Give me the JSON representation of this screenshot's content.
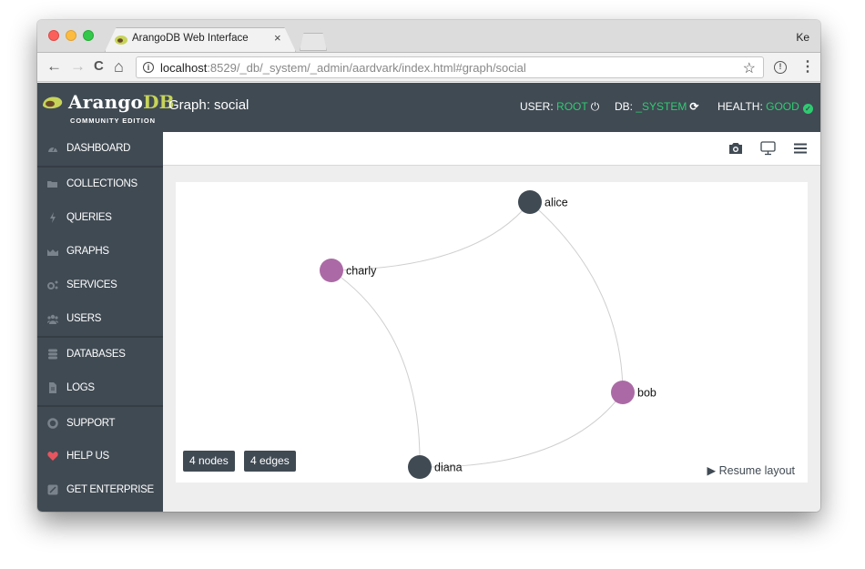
{
  "browser": {
    "tab_title": "ArangoDB Web Interface",
    "tab_close": "×",
    "profile": "Ke",
    "url_host": "localhost",
    "url_rest": ":8529/_db/_system/_admin/aardvark/index.html#graph/social",
    "back": "←",
    "forward": "→",
    "reload": "C",
    "home": "⌂",
    "info": "i",
    "star": "☆",
    "ext": "!",
    "menu": "⋮"
  },
  "header": {
    "logo_main": "Arango",
    "logo_db": "DB",
    "logo_sub": "COMMUNITY EDITION",
    "title": "Graph: social",
    "user_label": "USER:",
    "user_value": "ROOT",
    "db_label": "DB:",
    "db_value": "_SYSTEM",
    "health_label": "HEALTH:",
    "health_value": "GOOD",
    "power_icon": "⏻",
    "refresh_icon": "⟳",
    "check_icon": "✓"
  },
  "sidebar": {
    "items": [
      {
        "label": "DASHBOARD",
        "icon": "dashboard-icon"
      },
      {
        "label": "COLLECTIONS",
        "icon": "folder-icon"
      },
      {
        "label": "QUERIES",
        "icon": "bolt-icon"
      },
      {
        "label": "GRAPHS",
        "icon": "area-chart-icon"
      },
      {
        "label": "SERVICES",
        "icon": "cogs-icon"
      },
      {
        "label": "USERS",
        "icon": "users-icon"
      },
      {
        "label": "DATABASES",
        "icon": "database-icon"
      },
      {
        "label": "LOGS",
        "icon": "file-icon"
      },
      {
        "label": "SUPPORT",
        "icon": "life-ring-icon"
      },
      {
        "label": "HELP US",
        "icon": "heart-icon"
      },
      {
        "label": "GET ENTERPRISE",
        "icon": "external-link-icon"
      }
    ]
  },
  "graph": {
    "nodes": [
      {
        "id": "alice",
        "label": "alice",
        "color": "#404a53"
      },
      {
        "id": "charly",
        "label": "charly",
        "color": "#ab6aa5"
      },
      {
        "id": "bob",
        "label": "bob",
        "color": "#ab6aa5"
      },
      {
        "id": "diana",
        "label": "diana",
        "color": "#404a53"
      }
    ],
    "edges": [
      {
        "from": "alice",
        "to": "charly"
      },
      {
        "from": "alice",
        "to": "bob"
      },
      {
        "from": "bob",
        "to": "diana"
      },
      {
        "from": "charly",
        "to": "diana"
      }
    ],
    "nodes_badge": "4 nodes",
    "edges_badge": "4 edges",
    "resume_icon": "▶",
    "resume_label": "Resume layout"
  },
  "colors": {
    "header_bg": "#404a53",
    "accent_green": "#2ecc71",
    "logo_db": "#c7d45a",
    "heart": "#e8555f"
  }
}
